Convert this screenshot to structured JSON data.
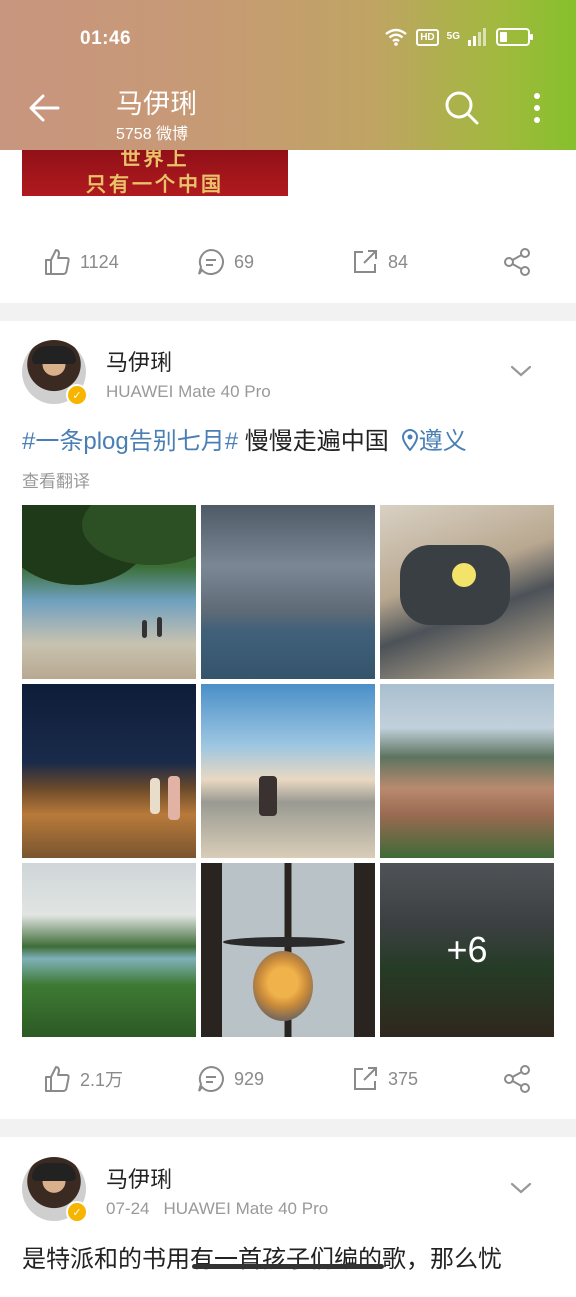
{
  "status_bar": {
    "time": "01:46",
    "hd": "HD",
    "network": "5G",
    "battery_level": 0.25
  },
  "header": {
    "title": "马伊琍",
    "subtitle": "5758 微博",
    "icons": [
      "back-arrow-icon",
      "search-icon",
      "more-vertical-icon"
    ]
  },
  "posts": [
    {
      "image_text": [
        "世界上",
        "只有一个中国"
      ],
      "actions": {
        "likes": "1124",
        "comments": "69",
        "reposts": "84"
      }
    },
    {
      "author": "马伊琍",
      "device": "HUAWEI Mate 40 Pro",
      "hashtag": "#一条plog告别七月#",
      "text": " 慢慢走遍中国",
      "location": "遵义",
      "translate_label": "查看翻译",
      "photos": [
        "beach-trees",
        "storm-sea",
        "woman-sofa",
        "night-beach",
        "woman-rock-beach",
        "coastal-town",
        "green-coast",
        "window-lamp",
        "village-hills"
      ],
      "more_photos": "+6",
      "actions": {
        "likes": "2.1万",
        "comments": "929",
        "reposts": "375"
      }
    },
    {
      "author": "马伊琍",
      "date": "07-24",
      "device": "HUAWEI Mate 40 Pro",
      "text": "是特派和的书用有一首孩子们编的歌，那么忧"
    }
  ],
  "colors": {
    "link": "#4a7fb5",
    "muted": "#999999",
    "verified": "#f7b500",
    "header_start": "#c8957e",
    "header_end": "#86c02c"
  }
}
